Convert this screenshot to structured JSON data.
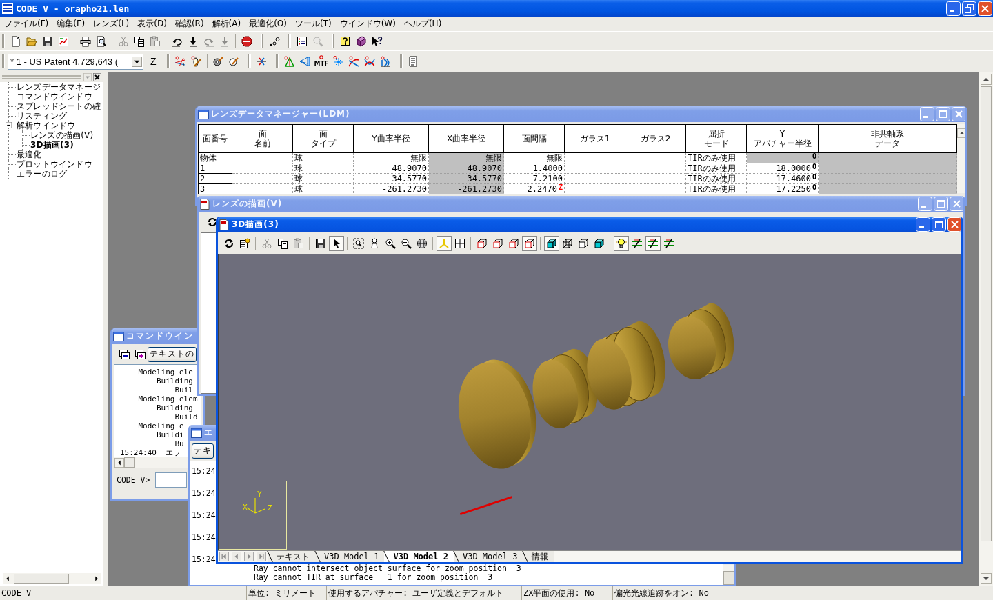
{
  "window": {
    "title": "CODE V - orapho21.len"
  },
  "menu": [
    "ファイル(F)",
    "編集(E)",
    "レンズ(L)",
    "表示(D)",
    "確認(R)",
    "解析(A)",
    "最適化(O)",
    "ツール(T)",
    "ウインドウ(W)",
    "ヘルプ(H)"
  ],
  "toolbar_row_1": [
    [
      [
        {
          "kind": "new",
          "disabled": false
        },
        {
          "kind": "open",
          "disabled": false
        },
        {
          "kind": "save",
          "disabled": false
        },
        {
          "kind": "chart",
          "disabled": false
        }
      ],
      [
        {
          "kind": "print",
          "disabled": false
        },
        {
          "kind": "preview",
          "disabled": false
        }
      ],
      [
        {
          "kind": "cut",
          "disabled": true
        },
        {
          "kind": "copy",
          "disabled": false
        },
        {
          "kind": "paste",
          "disabled": true
        }
      ],
      [
        {
          "kind": "undo",
          "disabled": false
        },
        {
          "kind": "import",
          "disabled": false
        },
        {
          "kind": "redo",
          "disabled": true
        },
        {
          "kind": "export",
          "disabled": true
        }
      ],
      [
        {
          "kind": "stop",
          "disabled": false
        }
      ]
    ],
    [
      [
        {
          "kind": "dots",
          "disabled": false
        }
      ]
    ],
    [
      [
        {
          "kind": "checklist",
          "disabled": false
        },
        {
          "kind": "lookup",
          "disabled": true
        }
      ]
    ],
    [
      [
        {
          "kind": "help",
          "disabled": false
        },
        {
          "kind": "book",
          "disabled": false
        },
        {
          "kind": "whatsthis",
          "disabled": false
        }
      ]
    ]
  ],
  "toolbar_row_2": {
    "lens_select": "* 1 - US Patent 4,729,643 (",
    "zoom_button": "Z",
    "toolbars": [
      [
        [
          {
            "kind": "raylens"
          },
          {
            "kind": "lensdraw"
          }
        ],
        [
          {
            "kind": "gearedit"
          },
          {
            "kind": "circleedit"
          }
        ]
      ],
      [
        [
          {
            "kind": "axis"
          }
        ]
      ],
      [
        [
          {
            "kind": "spot3"
          },
          {
            "kind": "fan"
          },
          {
            "kind": "mtf",
            "label": "MTF"
          },
          {
            "kind": "spot"
          },
          {
            "kind": "curves"
          },
          {
            "kind": "cross"
          },
          {
            "kind": "arc"
          }
        ]
      ],
      [
        [
          {
            "kind": "listing"
          }
        ]
      ]
    ]
  },
  "tree": [
    {
      "label": "レンズデータマネージ",
      "selected": false
    },
    {
      "label": "コマンドウインドウ",
      "selected": false
    },
    {
      "label": "スプレッドシートの確",
      "selected": false
    },
    {
      "label": "リスティング",
      "selected": false
    },
    {
      "label": "解析ウインドウ",
      "selected": false,
      "expanded": true,
      "children": [
        {
          "label": "レンズの描画(V)",
          "selected": false
        },
        {
          "label": "3D描画(3)",
          "selected": true
        }
      ]
    },
    {
      "label": "最適化",
      "selected": false
    },
    {
      "label": "プロットウインドウ",
      "selected": false
    },
    {
      "label": "エラーのログ",
      "selected": false
    }
  ],
  "ldm_window": {
    "title": "レンズデータマネージャー(LDM)",
    "active": false,
    "columns": [
      "面番号",
      "面名前",
      "面タイプ",
      "Y曲率半径",
      "X曲率半径",
      "面間隔",
      "ガラス1",
      "ガラス2",
      "屈折モード",
      "Y アパチャー半径",
      "非共軸系データ"
    ],
    "rows": [
      [
        {
          "text": "物体",
          "disabled": false
        },
        {
          "disabled": false
        },
        {
          "text": "球",
          "disabled": false
        },
        {
          "text": "無限",
          "disabled": false
        },
        {
          "text": "無限",
          "disabled": true
        },
        {
          "text": "無限",
          "disabled": false
        },
        {
          "disabled": false
        },
        {
          "disabled": false
        },
        {
          "text": "TIRのみ使用",
          "disabled": false
        },
        {
          "marker": {
            "text": "O",
            "kind": "solve"
          },
          "disabled": true
        },
        {
          "disabled": true
        }
      ],
      [
        {
          "text": "1",
          "disabled": false
        },
        {
          "disabled": false
        },
        {
          "text": "球",
          "disabled": false
        },
        {
          "text": "48.9070",
          "disabled": false
        },
        {
          "text": "48.9070",
          "disabled": true
        },
        {
          "text": "1.4000",
          "disabled": false
        },
        {
          "disabled": false
        },
        {
          "disabled": false
        },
        {
          "text": "TIRのみ使用",
          "disabled": false
        },
        {
          "text": "18.0000",
          "marker": {
            "text": "O",
            "kind": "solve"
          },
          "disabled": false
        },
        {
          "disabled": true
        }
      ],
      [
        {
          "text": "2",
          "disabled": false
        },
        {
          "disabled": false
        },
        {
          "text": "球",
          "disabled": false
        },
        {
          "text": "34.5770",
          "disabled": false
        },
        {
          "text": "34.5770",
          "disabled": true
        },
        {
          "text": "7.2100",
          "disabled": false
        },
        {
          "disabled": false
        },
        {
          "disabled": false
        },
        {
          "text": "TIRのみ使用",
          "disabled": false
        },
        {
          "text": "17.4600",
          "marker": {
            "text": "O",
            "kind": "solve"
          },
          "disabled": false
        },
        {
          "disabled": true
        }
      ],
      [
        {
          "text": "3",
          "disabled": false
        },
        {
          "disabled": false
        },
        {
          "text": "球",
          "disabled": false
        },
        {
          "text": "-261.2730",
          "disabled": false
        },
        {
          "text": "-261.2730",
          "disabled": true
        },
        {
          "text": "2.2470",
          "marker": {
            "text": "Z",
            "kind": "zoom"
          },
          "disabled": false
        },
        {
          "disabled": false
        },
        {
          "disabled": false
        },
        {
          "text": "TIRのみ使用",
          "disabled": false
        },
        {
          "text": "17.2250",
          "marker": {
            "text": "O",
            "kind": "solve"
          },
          "disabled": false
        },
        {
          "disabled": true
        }
      ]
    ]
  },
  "command_window": {
    "title": "コマンドウイン",
    "active": false,
    "tools": [
      {
        "kind": "minusdoc"
      },
      {
        "kind": "plusdoc"
      }
    ],
    "clear_button": "テキストの",
    "log": [
      {
        "kind": "output",
        "text": "Modeling ele",
        "children": [
          {
            "text": "Building",
            "children": [
              {
                "text": "Buil"
              }
            ]
          }
        ]
      },
      {
        "kind": "output",
        "text": "Modeling elem",
        "children": [
          {
            "text": "Building",
            "children": [
              {
                "text": "Build"
              }
            ]
          }
        ]
      },
      {
        "kind": "output",
        "text": "Modeling e",
        "children": [
          {
            "text": "Buildi",
            "children": [
              {
                "text": "Bu"
              }
            ]
          }
        ]
      },
      {
        "kind": "message",
        "text": "15:24:40  エラ"
      }
    ],
    "prompt": "CODE V>"
  },
  "lens_window": {
    "title": "レンズの描画(V)",
    "active": false,
    "tools": [
      {
        "kind": "refresh"
      }
    ]
  },
  "error_window": {
    "title": "エ",
    "active": false,
    "clear_button": "テキ",
    "times": [
      "15:24",
      "15:24",
      "15:24",
      "15:24",
      "15:24"
    ],
    "messages": [
      "Ray cannot intersect object surface for zoom position  3",
      "Ray cannot TIR at surface   1 for zoom position  3"
    ]
  },
  "view3d_window": {
    "title": "3D描画(3)",
    "active": true,
    "toolbar": [
      [
        {
          "kind": "refresh",
          "disabled": false,
          "on": false
        },
        {
          "kind": "props",
          "disabled": false,
          "on": false
        }
      ],
      [
        {
          "kind": "cut",
          "disabled": true,
          "on": false
        },
        {
          "kind": "copy",
          "disabled": false,
          "on": false
        },
        {
          "kind": "paste",
          "disabled": true,
          "on": false
        }
      ],
      [
        {
          "kind": "save",
          "disabled": false,
          "on": false
        },
        {
          "kind": "pointer",
          "disabled": false,
          "on": true
        }
      ],
      [
        {
          "kind": "zoombox",
          "disabled": false,
          "on": false
        },
        {
          "kind": "pan",
          "disabled": false,
          "on": false
        },
        {
          "kind": "zoomin",
          "disabled": false,
          "on": false
        },
        {
          "kind": "zoomout",
          "disabled": false,
          "on": false
        },
        {
          "kind": "reset",
          "disabled": false,
          "on": false
        }
      ],
      [
        {
          "kind": "axes",
          "disabled": false,
          "on": true
        },
        {
          "kind": "grid",
          "disabled": false,
          "on": false
        }
      ],
      [
        {
          "kind": "edgecube",
          "disabled": false,
          "on": false
        },
        {
          "kind": "edgecube",
          "disabled": false,
          "on": false
        },
        {
          "kind": "edgecube",
          "disabled": false,
          "on": false
        },
        {
          "kind": "edgecube",
          "disabled": false,
          "on": true
        }
      ],
      [
        {
          "kind": "solidcube",
          "disabled": false,
          "on": true
        },
        {
          "kind": "wirecube",
          "disabled": false,
          "on": false
        },
        {
          "kind": "outlinecube",
          "disabled": false,
          "on": false
        },
        {
          "kind": "solidcube",
          "disabled": false,
          "on": false
        }
      ],
      [
        {
          "kind": "bulb",
          "disabled": false,
          "on": true
        },
        {
          "kind": "lines",
          "disabled": false,
          "on": false
        },
        {
          "kind": "lines",
          "disabled": false,
          "on": true
        },
        {
          "kind": "lines",
          "disabled": false,
          "on": false
        }
      ]
    ],
    "axis_labels": [
      "X",
      "Y",
      "Z"
    ],
    "tabs": [
      {
        "label": "テキスト",
        "selected": false
      },
      {
        "label": "V3D Model 1",
        "selected": false
      },
      {
        "label": "V3D Model 2",
        "selected": true
      },
      {
        "label": "V3D Model 3",
        "selected": false
      },
      {
        "label": "情報",
        "selected": false
      }
    ]
  },
  "status_bar": [
    "CODE V",
    "単位: ミリメート",
    "使用するアパチャー: ユーザ定義とデフォルト",
    "ZX平面の使用: No",
    "偏光光線追跡をオン: No"
  ]
}
